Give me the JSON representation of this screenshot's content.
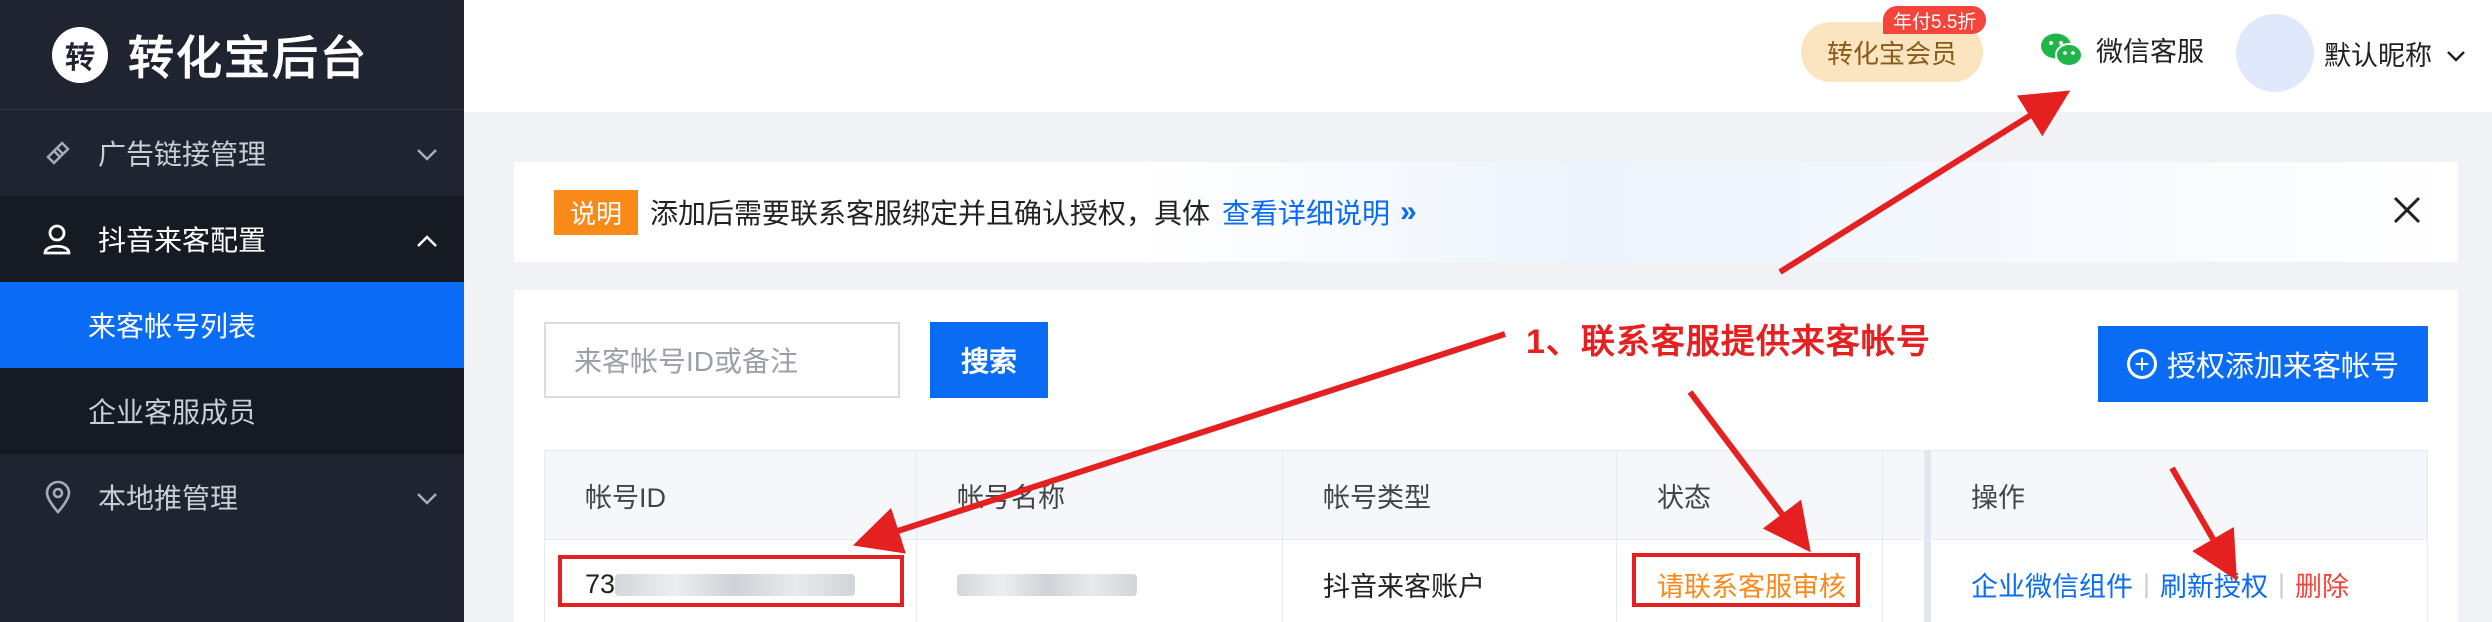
{
  "brand": {
    "logo_char": "转",
    "title": "转化宝后台"
  },
  "sidebar": {
    "items": [
      {
        "label": "广告链接管理",
        "icon": "link-icon",
        "state": "collapsed"
      },
      {
        "label": "抖音来客配置",
        "icon": "user-icon",
        "state": "expanded",
        "children": [
          {
            "label": "来客帐号列表",
            "active": true
          },
          {
            "label": "企业客服成员",
            "active": false
          }
        ]
      },
      {
        "label": "本地推管理",
        "icon": "location-icon",
        "state": "collapsed"
      }
    ]
  },
  "header": {
    "vip_label": "转化宝会员",
    "vip_badge": "年付5.5折",
    "service_label": "微信客服",
    "nickname": "默认昵称"
  },
  "notice": {
    "tag": "说明",
    "text": "添加后需要联系客服绑定并且确认授权，具体",
    "link": "查看详细说明",
    "arrows": "»"
  },
  "toolbar": {
    "search_placeholder": "来客帐号ID或备注",
    "search_button": "搜索",
    "add_button": "授权添加来客帐号"
  },
  "table": {
    "headers": [
      "帐号ID",
      "帐号名称",
      "帐号类型",
      "状态",
      "操作"
    ],
    "rows": [
      {
        "id_prefix": "73",
        "type": "抖音来客账户",
        "status": "请联系客服审核",
        "actions": [
          "企业微信组件",
          "刷新授权",
          "删除"
        ]
      }
    ]
  },
  "annotation": {
    "text": "1、联系客服提供来客帐号",
    "color": "#e52020"
  },
  "colors": {
    "primary": "#0a6cf5",
    "sidebar_bg": "#1f2430",
    "warn": "#f98a1a",
    "danger": "#f5443b"
  }
}
